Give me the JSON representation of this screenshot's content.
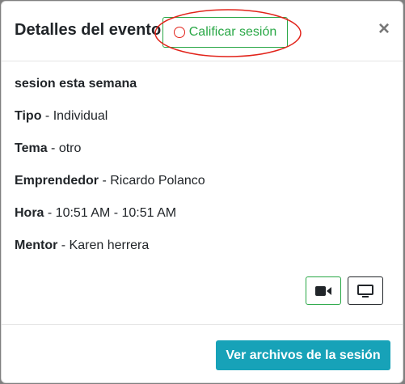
{
  "modal": {
    "title": "Detalles del evento",
    "rate_button_label": "Calificar sesión",
    "close_symbol": "×"
  },
  "event": {
    "name": "sesion esta semana",
    "fields": [
      {
        "label": "Tipo",
        "separator": " - ",
        "value": "Individual"
      },
      {
        "label": "Tema",
        "separator": " - ",
        "value": "otro"
      },
      {
        "label": "Emprendedor",
        "separator": " - ",
        "value": "Ricardo Polanco"
      },
      {
        "label": "Hora",
        "separator": " - ",
        "value": "10:51 AM - 10:51 AM"
      },
      {
        "label": "Mentor",
        "separator": " - ",
        "value": "Karen herrera"
      }
    ]
  },
  "actions": {
    "video_icon": "video-camera-icon",
    "screen_icon": "monitor-icon",
    "files_button_label": "Ver archivos de la sesión"
  },
  "colors": {
    "success": "#28a745",
    "info": "#17a2b8",
    "annotation": "#e2231a"
  }
}
